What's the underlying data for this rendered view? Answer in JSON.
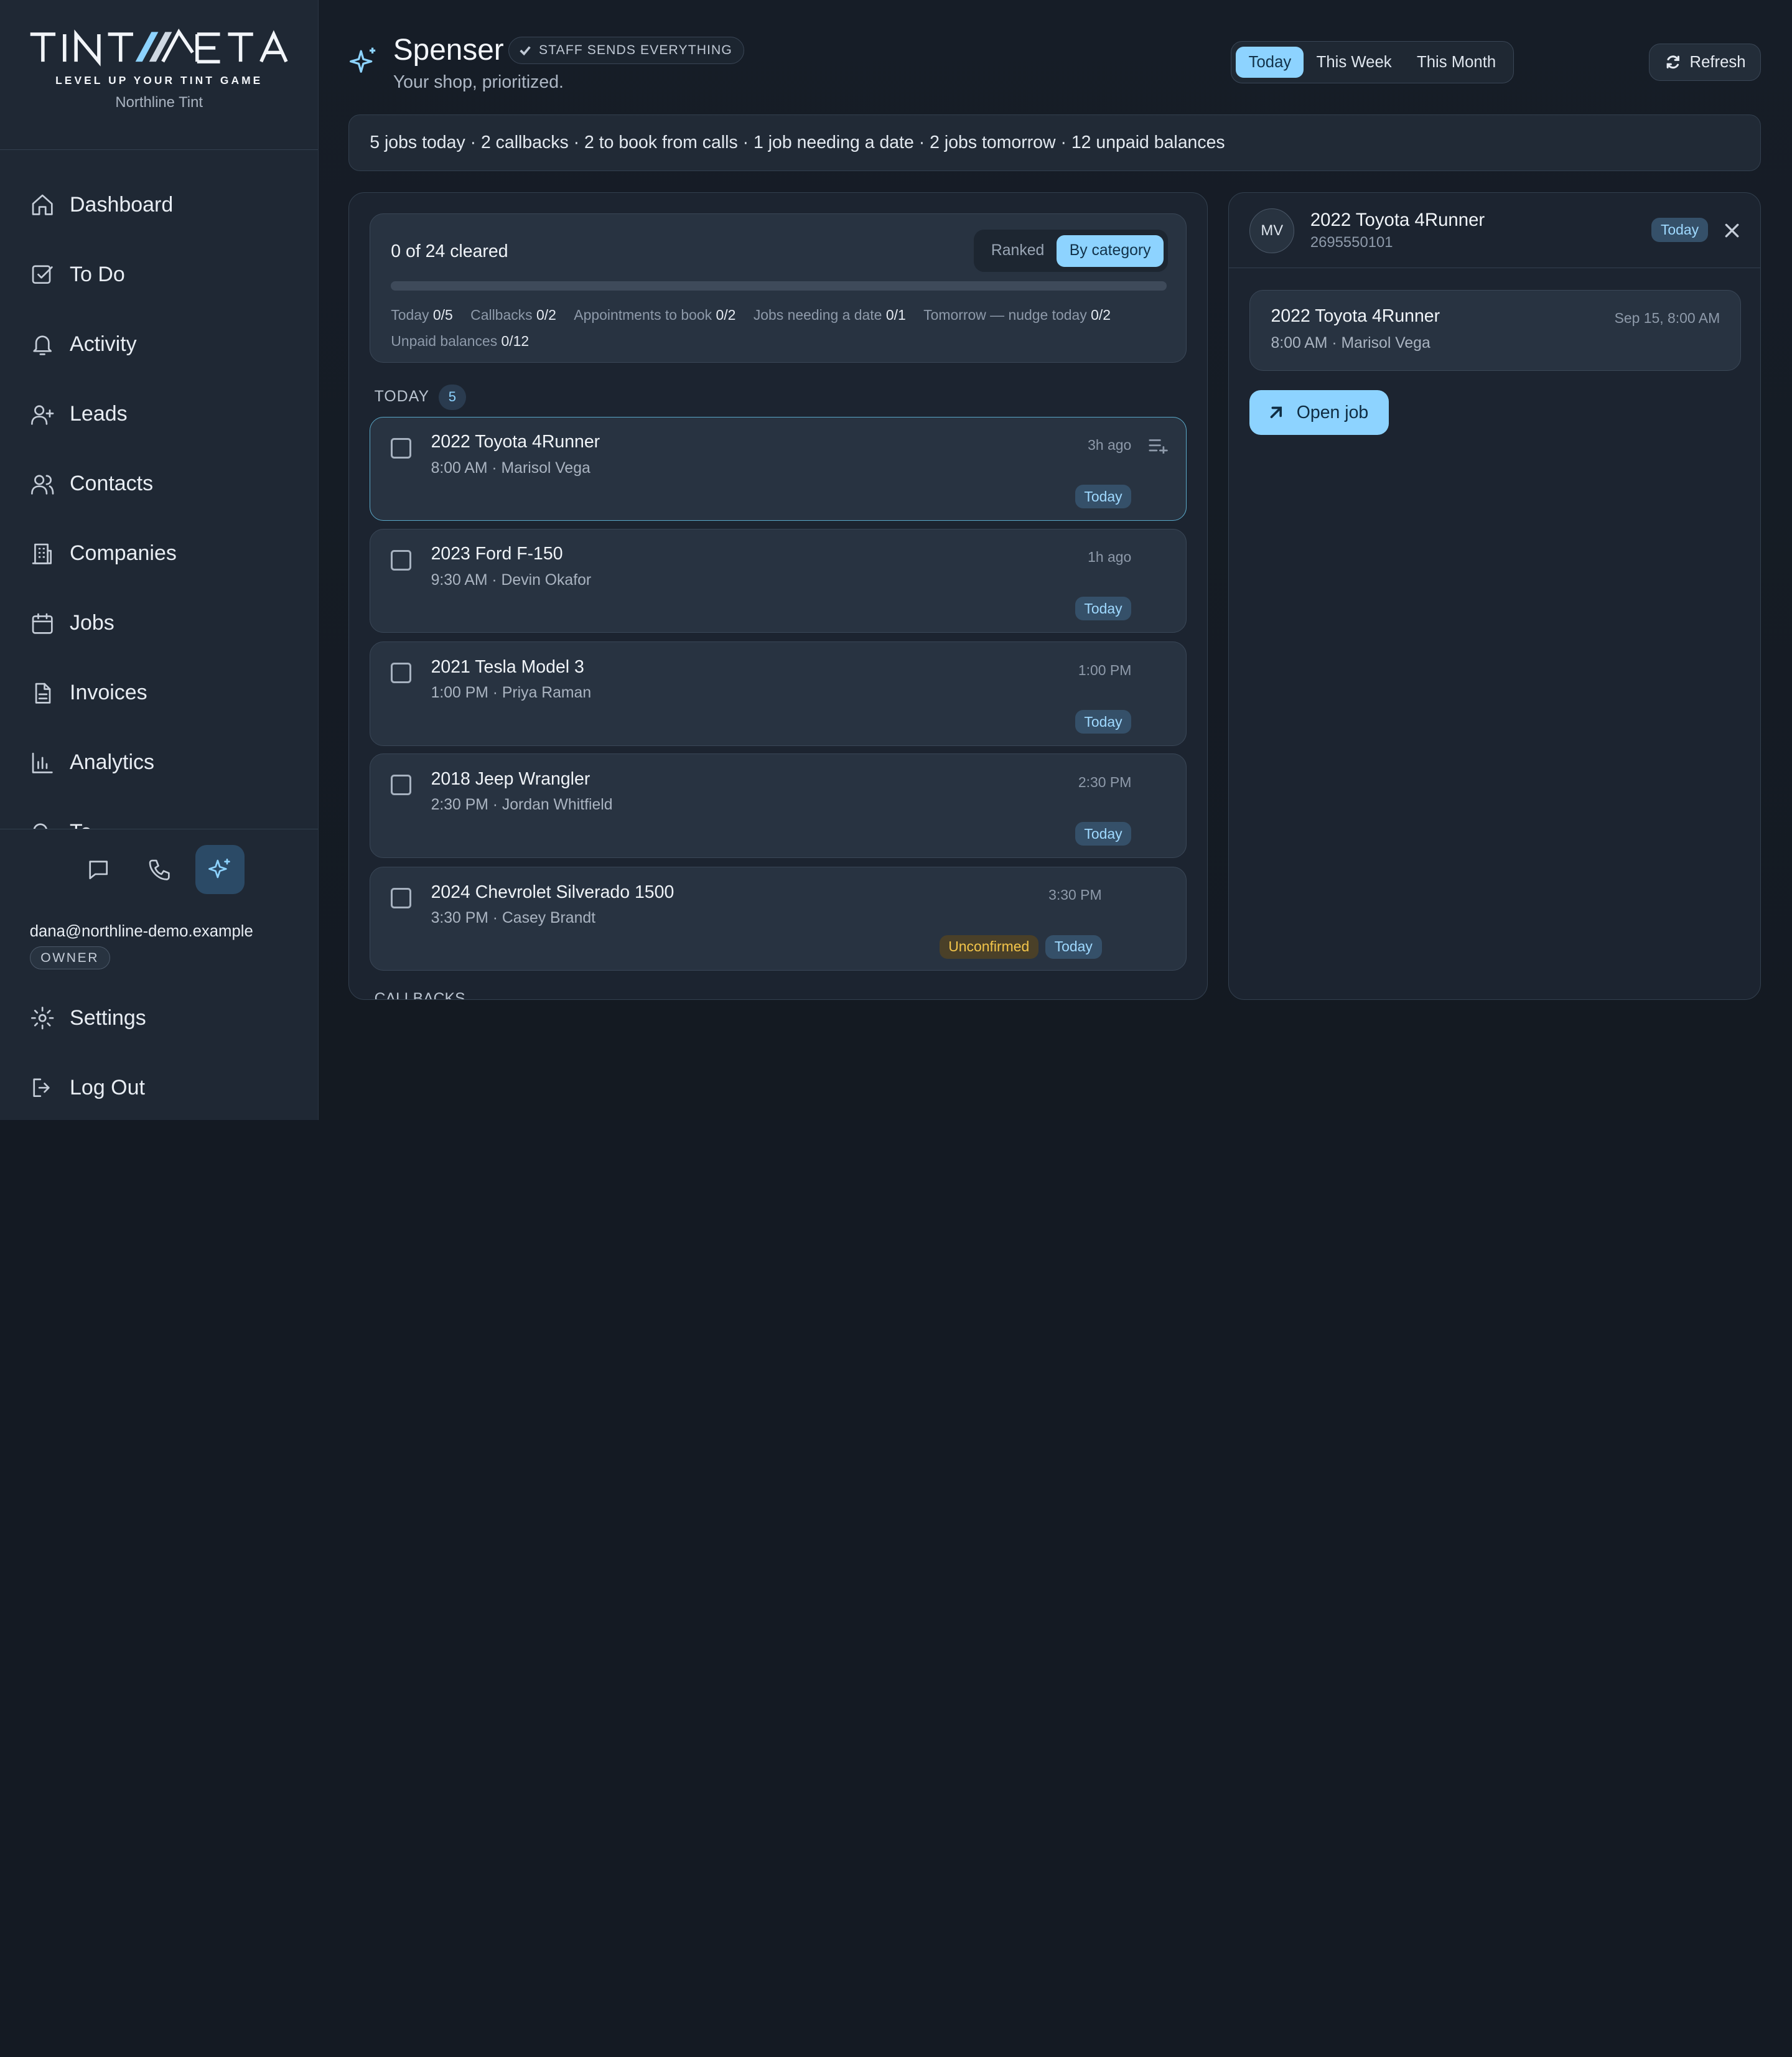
{
  "brand": {
    "logo_text": "TINTMETA",
    "tagline": "LEVEL UP YOUR TINT GAME",
    "shop_name": "Northline Tint"
  },
  "nav": [
    {
      "label": "Dashboard",
      "icon": "home-icon"
    },
    {
      "label": "To Do",
      "icon": "checkbox-icon"
    },
    {
      "label": "Activity",
      "icon": "bell-icon"
    },
    {
      "label": "Leads",
      "icon": "user-plus-icon"
    },
    {
      "label": "Contacts",
      "icon": "users-icon"
    },
    {
      "label": "Companies",
      "icon": "building-icon"
    },
    {
      "label": "Jobs",
      "icon": "calendar-icon"
    },
    {
      "label": "Invoices",
      "icon": "document-icon"
    },
    {
      "label": "Analytics",
      "icon": "bar-chart-icon"
    },
    {
      "label": "Te",
      "icon": "partial-icon"
    }
  ],
  "sidebar_bottom": {
    "quick_actions": [
      "messages-icon",
      "phone-icon",
      "sparkle-icon"
    ],
    "user_email": "dana@northline-demo.example",
    "role": "OWNER",
    "settings_label": "Settings",
    "logout_label": "Log Out"
  },
  "header": {
    "title": "Spenser",
    "badge": "STAFF SENDS EVERYTHING",
    "subtitle": "Your shop, prioritized.",
    "range_tabs": [
      "Today",
      "This Week",
      "This Month"
    ],
    "active_range": "Today",
    "refresh_label": "Refresh"
  },
  "summary": "5 jobs today · 2 callbacks · 2 to book from calls · 1 job needing a date · 2 jobs tomorrow · 12 unpaid balances",
  "progress": {
    "cleared_text": "0 of 24 cleared",
    "cleared_fraction": 0,
    "view_tabs": [
      "Ranked",
      "By category"
    ],
    "active_view": "By category",
    "categories": [
      {
        "label": "Today",
        "value": "0/5"
      },
      {
        "label": "Callbacks",
        "value": "0/2"
      },
      {
        "label": "Appointments to book",
        "value": "0/2"
      },
      {
        "label": "Jobs needing a date",
        "value": "0/1"
      },
      {
        "label": "Tomorrow — nudge today",
        "value": "0/2"
      },
      {
        "label": "Unpaid balances",
        "value": "0/12"
      }
    ]
  },
  "section": {
    "label": "TODAY",
    "count": "5",
    "next_label": "CALLBACKS"
  },
  "tasks": [
    {
      "title": "2022 Toyota 4Runner",
      "sub": "8:00 AM · Marisol Vega",
      "time": "3h ago",
      "badges": [
        "Today"
      ]
    },
    {
      "title": "2023 Ford F-150",
      "sub": "9:30 AM · Devin Okafor",
      "time": "1h ago",
      "badges": [
        "Today"
      ]
    },
    {
      "title": "2021 Tesla Model 3",
      "sub": "1:00 PM · Priya Raman",
      "time": "1:00 PM",
      "badges": [
        "Today"
      ]
    },
    {
      "title": "2018 Jeep Wrangler",
      "sub": "2:30 PM · Jordan Whitfield",
      "time": "2:30 PM",
      "badges": [
        "Today"
      ]
    },
    {
      "title": "2024 Chevrolet Silverado 1500",
      "sub": "3:30 PM · Casey Brandt",
      "time": "3:30 PM",
      "badges": [
        "Unconfirmed",
        "Today"
      ]
    }
  ],
  "detail": {
    "initials": "MV",
    "title": "2022 Toyota 4Runner",
    "phone": "2695550101",
    "pill": "Today",
    "event": {
      "title": "2022 Toyota 4Runner",
      "sub": "8:00 AM · Marisol Vega",
      "date": "Sep 15, 8:00 AM"
    },
    "open_label": "Open job"
  },
  "colors": {
    "accent": "#8dd3ff",
    "warning": "#f3c54a",
    "background": "#141a23",
    "surface": "#283341"
  }
}
